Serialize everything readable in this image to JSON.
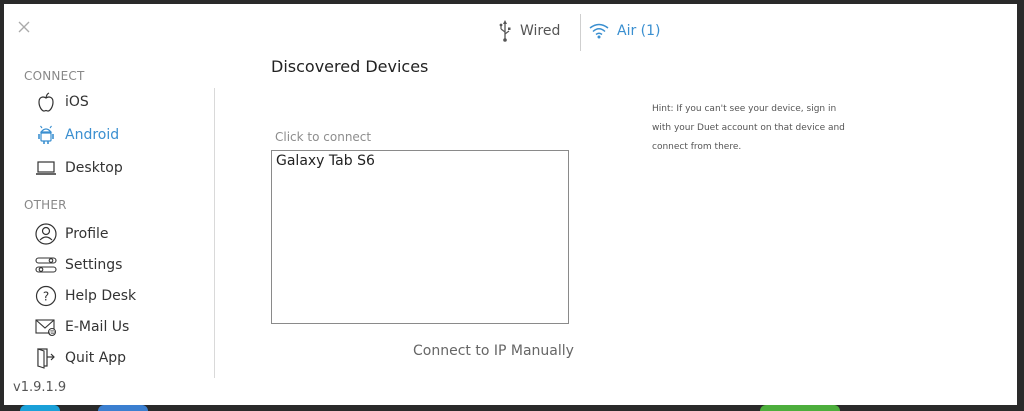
{
  "topbar": {
    "wired_label": "Wired",
    "air_label": "Air (1)"
  },
  "sidebar": {
    "connect_heading": "CONNECT",
    "connect_items": [
      {
        "label": "iOS",
        "icon": "apple-icon"
      },
      {
        "label": "Android",
        "icon": "android-icon",
        "active": true
      },
      {
        "label": "Desktop",
        "icon": "laptop-icon"
      }
    ],
    "other_heading": "OTHER",
    "other_items": [
      {
        "label": "Profile",
        "icon": "profile-icon"
      },
      {
        "label": "Settings",
        "icon": "settings-icon"
      },
      {
        "label": "Help Desk",
        "icon": "help-icon"
      },
      {
        "label": "E-Mail Us",
        "icon": "email-icon"
      },
      {
        "label": "Quit App",
        "icon": "quit-icon"
      }
    ],
    "version": "v1.9.1.9"
  },
  "main": {
    "title": "Discovered Devices",
    "click_hint": "Click to connect",
    "devices": [
      "Galaxy Tab S6"
    ],
    "connect_ip_label": "Connect to IP Manually",
    "hint": "Hint: If you can't see your device, sign in with your Duet account on that device and connect from there."
  },
  "colors": {
    "accent": "#3a8fd0",
    "text": "#333333",
    "muted": "#888888"
  }
}
